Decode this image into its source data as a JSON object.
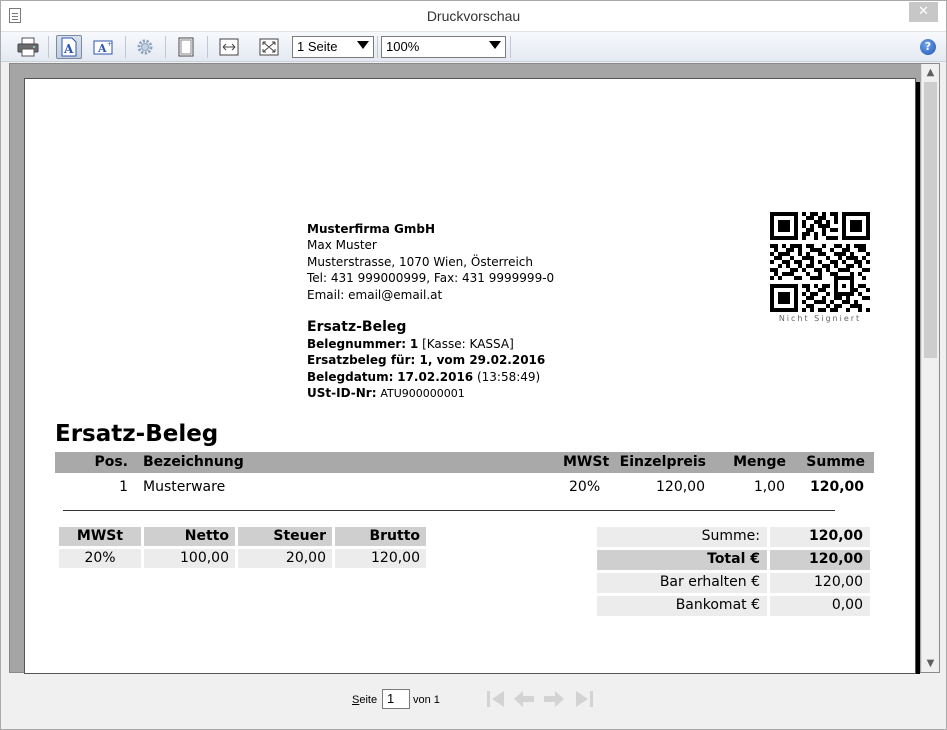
{
  "window": {
    "title": "Druckvorschau",
    "close_label": "✕"
  },
  "toolbar": {
    "pages_select": {
      "value": "1 Seite"
    },
    "zoom_select": {
      "value": "100%"
    },
    "help_label": "?"
  },
  "document": {
    "company": {
      "name": "Musterfirma GmbH",
      "contact": "Max Muster",
      "address": "Musterstrasse, 1070 Wien, Österreich",
      "phone_fax": "Tel: 431 999000999, Fax: 431 9999999-0",
      "email": "Email: email@email.at"
    },
    "qr_caption": "Nicht Signiert",
    "receipt": {
      "type": "Ersatz-Beleg",
      "number_label": "Belegnummer:",
      "number_value": "1",
      "register": "[Kasse: KASSA]",
      "replacement_label": "Ersatzbeleg für:",
      "replacement_value": "1, vom 29.02.2016",
      "date_label": "Belegdatum:",
      "date_value": "17.02.2016",
      "time_value": "(13:58:49)",
      "vat_label": "USt-ID-Nr:",
      "vat_value": "ATU900000001"
    },
    "title": "Ersatz-Beleg",
    "items_columns": [
      "Pos.",
      "Bezeichnung",
      "MWSt",
      "Einzelpreis",
      "Menge",
      "Summe"
    ],
    "items": [
      {
        "pos": "1",
        "name": "Musterware",
        "vat": "20%",
        "unit_price": "120,00",
        "qty": "1,00",
        "sum": "120,00"
      }
    ],
    "tax_table": {
      "columns": [
        "MWSt",
        "Netto",
        "Steuer",
        "Brutto"
      ],
      "rows": [
        {
          "vat": "20%",
          "net": "100,00",
          "tax": "20,00",
          "gross": "120,00"
        }
      ]
    },
    "summary": {
      "sum_label": "Summe:",
      "sum_value": "120,00",
      "total_label": "Total €",
      "total_value": "120,00",
      "cash_label": "Bar erhalten €",
      "cash_value": "120,00",
      "card_label": "Bankomat €",
      "card_value": "0,00"
    }
  },
  "statusbar": {
    "page_label": "Seite",
    "page_value": "1",
    "of_label": "von 1"
  }
}
